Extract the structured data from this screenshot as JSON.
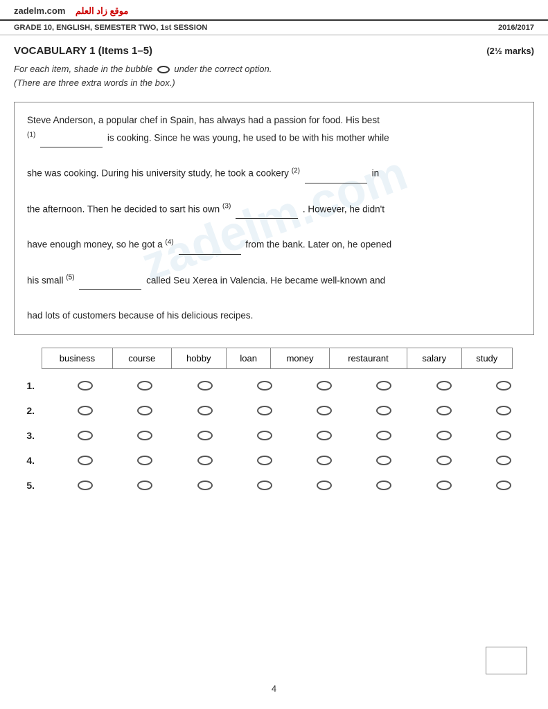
{
  "header": {
    "logo_text": "zadelm.com",
    "logo_arabic": "موقع زاد العلم",
    "grade_info": "GRADE 10, ENGLISH, SEMESTER TWO, 1st SESSION",
    "year": "2016/2017"
  },
  "section": {
    "title": "VOCABULARY 1 (Items 1–5)",
    "marks": "(2½ marks)",
    "instruction1": "For each item, shade in the bubble   under the correct option.",
    "instruction2": "(There are three extra words in the box.)"
  },
  "passage": {
    "text_intro": "Steve Anderson, a popular chef in Spain, has always had a passion for food. His best",
    "blank1_label": "(1)",
    "text1": " is cooking. Since he was young, he used to be with his mother while she was cooking. During his university study, he took a cookery ",
    "blank2_label": "(2)",
    "text2": " in the afternoon. Then he decided to sart his own ",
    "blank3_label": "(3)",
    "text3": ". However, he didn't have enough money, so he got a ",
    "blank4_label": "(4)",
    "text4": " from the bank. Later on, he opened his small ",
    "blank5_label": "(5)",
    "text5": " called Seu Xerea in Valencia. He became well-known and had lots of customers because of his delicious recipes."
  },
  "word_box": {
    "columns": [
      "business",
      "course",
      "hobby",
      "loan",
      "money",
      "restaurant",
      "salary",
      "study"
    ]
  },
  "rows": [
    {
      "number": "1."
    },
    {
      "number": "2."
    },
    {
      "number": "3."
    },
    {
      "number": "4."
    },
    {
      "number": "5."
    }
  ],
  "page_number": "4"
}
